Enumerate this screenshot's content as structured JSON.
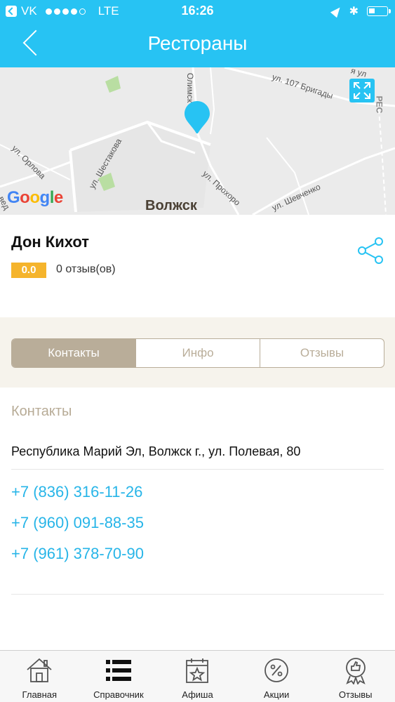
{
  "status_bar": {
    "carrier": "VK",
    "network": "LTE",
    "time": "16:26"
  },
  "nav": {
    "title": "Рестораны"
  },
  "map": {
    "streets": [
      "ул. 107 Бригады",
      "ул. Шестакова",
      "ул. Орлова",
      "ул. Прохоро",
      "ул. Шевченко",
      "Олимск",
      "РЕС",
      "я ул",
      "вед"
    ],
    "city": "Волжск",
    "attribution": "Google"
  },
  "place": {
    "name": "Дон Кихот",
    "rating": "0.0",
    "reviews": "0 отзыв(ов)"
  },
  "tabs": [
    {
      "label": "Контакты",
      "active": true
    },
    {
      "label": "Инфо",
      "active": false
    },
    {
      "label": "Отзывы",
      "active": false
    }
  ],
  "contacts": {
    "title": "Контакты",
    "address": "Республика Марий Эл, Волжск г., ул. Полевая, 80",
    "phones": [
      "+7 (836) 316-11-26",
      "+7 (960) 091-88-35",
      "+7 (961) 378-70-90"
    ]
  },
  "tabbar": [
    {
      "label": "Главная",
      "icon": "home-icon"
    },
    {
      "label": "Справочник",
      "icon": "list-icon",
      "active": true
    },
    {
      "label": "Афиша",
      "icon": "calendar-star-icon"
    },
    {
      "label": "Акции",
      "icon": "discount-icon"
    },
    {
      "label": "Отзывы",
      "icon": "thumbs-up-badge-icon"
    }
  ],
  "colors": {
    "accent": "#27c3f3",
    "rating": "#f5b42c",
    "tab": "#b9ad99",
    "phone": "#27b5e8"
  }
}
